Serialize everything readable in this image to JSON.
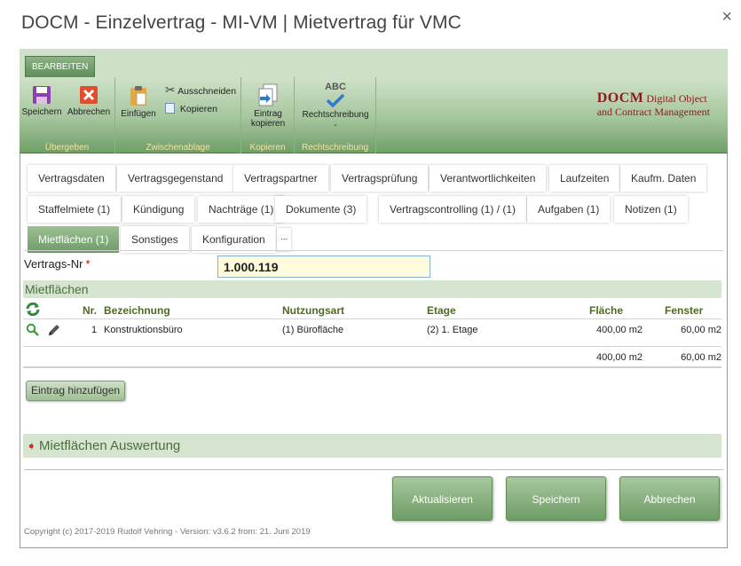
{
  "window": {
    "title": "DOCM - Einzelvertrag - MI-VM | Mietvertrag für VMC",
    "close_glyph": "×"
  },
  "ribbon": {
    "tab_label": "BEARBEITEN",
    "groups": {
      "uebergeben": {
        "label": "Übergeben",
        "save": "Speichern",
        "cancel": "Abbrechen"
      },
      "zwischenablage": {
        "label": "Zwischenablage",
        "paste": "Einfügen",
        "cut": "Ausschneiden",
        "copy": "Kopieren"
      },
      "kopieren": {
        "label": "Kopieren",
        "copy_entry_line1": "Eintrag",
        "copy_entry_line2": "kopieren"
      },
      "rechtschreibung": {
        "label": "Rechtschreibung",
        "spellcheck": "Rechtschreibung",
        "spellcheck_sub": "-",
        "abc": "ABC"
      }
    },
    "brand_line1": "DOCM",
    "brand_line1_rest": "Digital Object",
    "brand_line2": "and Contract Management"
  },
  "tabs": {
    "row1": [
      "Vertragsdaten",
      "Vertragsgegenstand",
      "Vertragspartner",
      "Vertragsprüfung",
      "Verantwortlichkeiten",
      "Laufzeiten",
      "Kaufm. Daten"
    ],
    "row2": [
      "Staffelmiete (1)",
      "Kündigung",
      "Nachträge (1)",
      "Dokumente (3)",
      "Vertragscontrolling (1) / (1)",
      "Aufgaben (1)",
      "Notizen (1)"
    ],
    "row3": [
      "Mietflächen (1)",
      "Sonstiges",
      "Konfiguration",
      "..."
    ]
  },
  "form": {
    "vertrags_nr_label": "Vertrags-Nr",
    "required_mark": "*",
    "vertrags_nr_value": "1.000.119"
  },
  "mietflaechen": {
    "title": "Mietflächen",
    "columns": {
      "nr": "Nr.",
      "bezeichnung": "Bezeichnung",
      "nutzungsart": "Nutzungsart",
      "etage": "Etage",
      "flaeche": "Fläche",
      "fenster": "Fenster"
    },
    "rows": [
      {
        "nr": "1",
        "bezeichnung": "Konstruktionsbüro",
        "nutzungsart": "(1) Bürofläche",
        "etage": "(2) 1. Etage",
        "flaeche": "400,00 m2",
        "fenster": "60,00 m2"
      }
    ],
    "totals": {
      "flaeche": "400,00 m2",
      "fenster": "60,00 m2"
    },
    "add_button": "Eintrag hinzufügen"
  },
  "auswertung": {
    "title": "Mietflächen Auswertung"
  },
  "actions": {
    "refresh": "Aktualisieren",
    "save": "Speichern",
    "cancel": "Abbrechen"
  },
  "footer": {
    "copyright": "Copyright (c) 2017-2019 Rudolf Vehring - Version: v3.6.2 from: 21. Juni 2019"
  },
  "colors": {
    "accent_green": "#6f9c66",
    "brand_red": "#8b1a1a",
    "input_bg": "#fffbdc"
  }
}
